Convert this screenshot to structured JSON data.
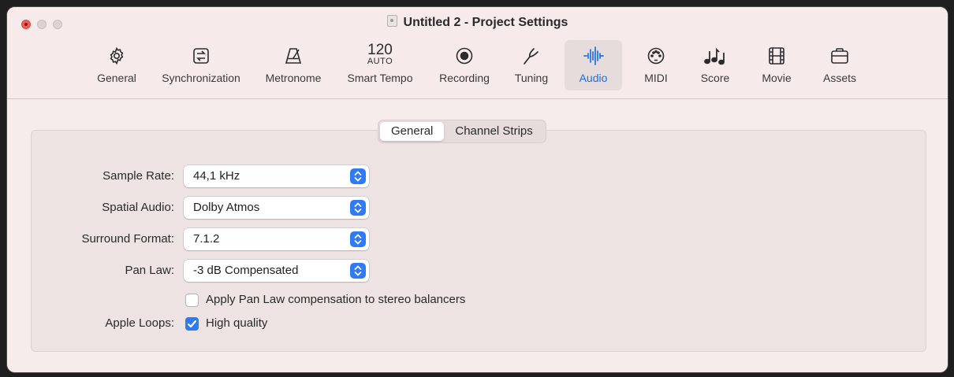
{
  "window": {
    "title": "Untitled 2 - Project Settings"
  },
  "toolbar": {
    "items": [
      {
        "label": "General",
        "icon": "gear-icon"
      },
      {
        "label": "Synchronization",
        "icon": "sync-icon"
      },
      {
        "label": "Metronome",
        "icon": "metronome-icon"
      },
      {
        "label": "Smart Tempo",
        "icon": "tempo-icon",
        "icon_number": "120",
        "icon_sub": "AUTO"
      },
      {
        "label": "Recording",
        "icon": "record-icon"
      },
      {
        "label": "Tuning",
        "icon": "tuning-fork-icon"
      },
      {
        "label": "Audio",
        "icon": "waveform-icon",
        "active": true
      },
      {
        "label": "MIDI",
        "icon": "midi-icon"
      },
      {
        "label": "Score",
        "icon": "notes-icon"
      },
      {
        "label": "Movie",
        "icon": "film-icon"
      },
      {
        "label": "Assets",
        "icon": "briefcase-icon"
      }
    ]
  },
  "tabs": {
    "general": "General",
    "channel_strips": "Channel Strips",
    "selected": "General"
  },
  "form": {
    "sample_rate": {
      "label": "Sample Rate:",
      "value": "44,1 kHz"
    },
    "spatial_audio": {
      "label": "Spatial Audio:",
      "value": "Dolby Atmos"
    },
    "surround_format": {
      "label": "Surround Format:",
      "value": "7.1.2"
    },
    "pan_law": {
      "label": "Pan Law:",
      "value": "-3 dB Compensated"
    },
    "pan_law_compensation": {
      "label": "Apply Pan Law compensation to stereo balancers",
      "checked": false
    },
    "apple_loops": {
      "label": "Apple Loops:",
      "option_label": "High quality",
      "checked": true
    }
  },
  "colors": {
    "accent": "#2f7bf5",
    "active_toolbar": "#1f6fe5",
    "window_bg": "#f6eceb",
    "close_button": "#ee5f57"
  }
}
